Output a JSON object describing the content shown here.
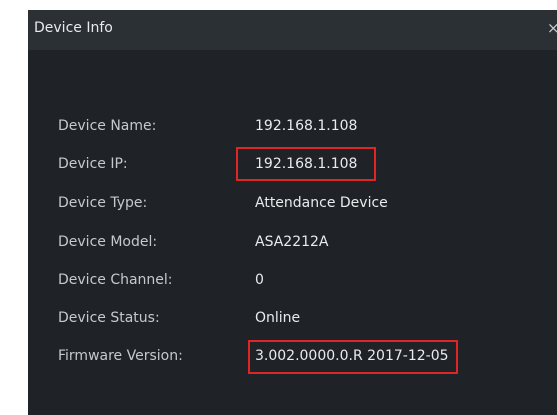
{
  "window": {
    "title": "Device Info",
    "close_glyph": "×"
  },
  "fields": [
    {
      "label": "Device Name:",
      "value": "192.168.1.108"
    },
    {
      "label": "Device IP:",
      "value": "192.168.1.108"
    },
    {
      "label": "Device Type:",
      "value": "Attendance Device"
    },
    {
      "label": "Device Model:",
      "value": "ASA2212A"
    },
    {
      "label": "Device Channel:",
      "value": "0"
    },
    {
      "label": "Device Status:",
      "value": "Online"
    },
    {
      "label": "Firmware Version:",
      "value": "3.002.0000.0.R 2017-12-05"
    }
  ],
  "colors": {
    "background": "#1f2327",
    "titlebar": "#2b3035",
    "label_text": "#c6c9cc",
    "value_text": "#e9ebed",
    "highlight": "#e02525"
  }
}
